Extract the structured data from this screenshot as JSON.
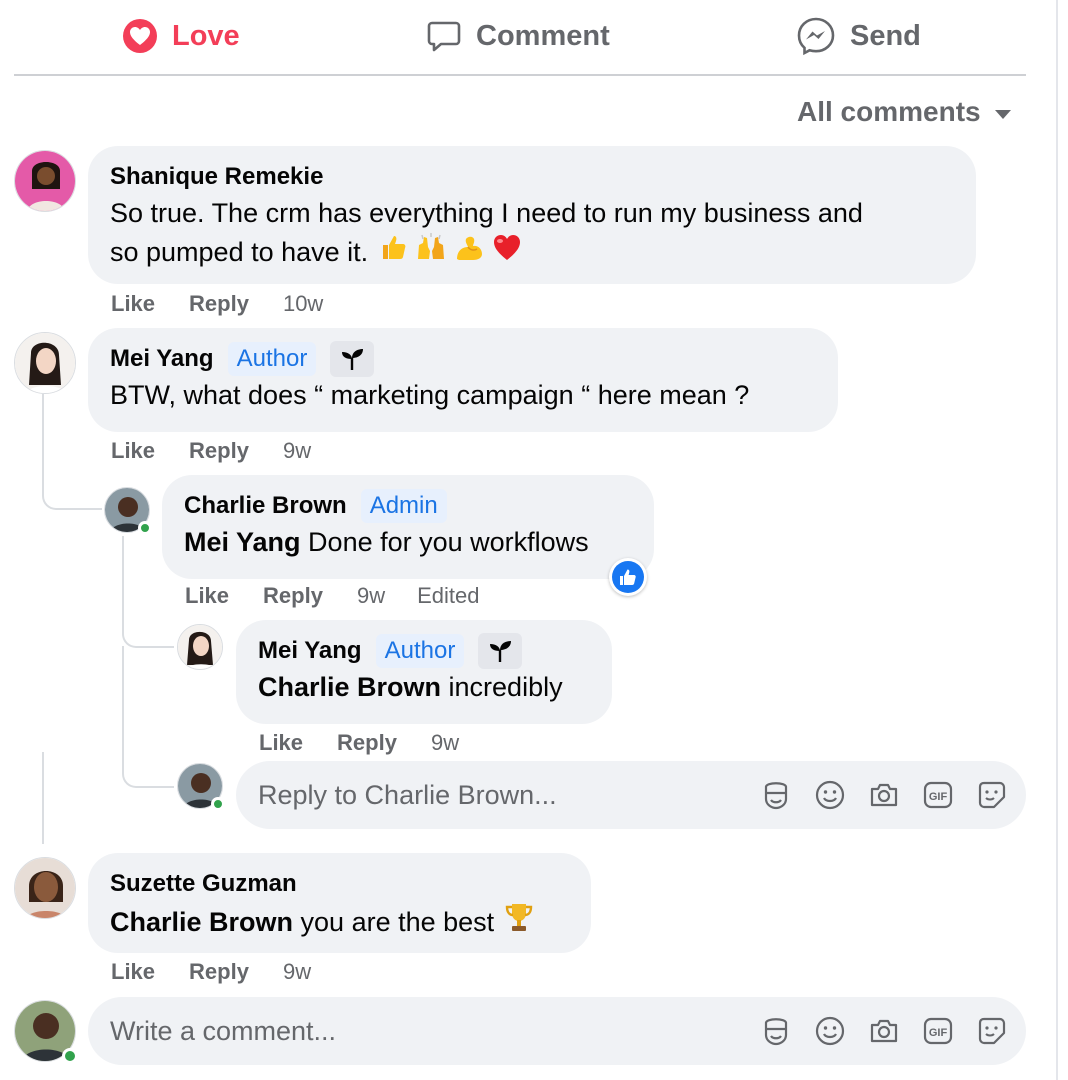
{
  "actions": {
    "love_label": "Love",
    "comment_label": "Comment",
    "send_label": "Send"
  },
  "filter": {
    "label": "All comments"
  },
  "comments": [
    {
      "author": "Shanique Remekie",
      "text_line1": "So true. The crm has everything I need to run my business and",
      "text_line2": "so pumped to have it.",
      "emojis": [
        "thumbs-up",
        "raising-hands",
        "flexed-biceps",
        "red-heart"
      ],
      "like": "Like",
      "reply": "Reply",
      "time": "10w"
    },
    {
      "author": "Mei Yang",
      "badge": "Author",
      "text": "BTW, what does “ marketing campaign “ here mean ?",
      "like": "Like",
      "reply": "Reply",
      "time": "9w",
      "replies": [
        {
          "author": "Charlie Brown",
          "badge": "Admin",
          "mention": "Mei Yang",
          "text": " Done for you workflows",
          "reaction": "like",
          "like": "Like",
          "reply": "Reply",
          "time": "9w",
          "edited": "Edited"
        },
        {
          "author": "Mei Yang",
          "badge": "Author",
          "mention": "Charlie Brown",
          "text": " incredibly",
          "like": "Like",
          "reply": "Reply",
          "time": "9w"
        }
      ],
      "reply_input_placeholder": "Reply to Charlie Brown..."
    },
    {
      "author": "Suzette Guzman",
      "mention": "Charlie Brown",
      "text": " you are the best",
      "emoji": "trophy",
      "like": "Like",
      "reply": "Reply",
      "time": "9w"
    }
  ],
  "composer": {
    "placeholder": "Write a comment..."
  },
  "input_icons": [
    "avatar-sticker-icon",
    "emoji-icon",
    "camera-icon",
    "gif-icon",
    "sticker-icon"
  ],
  "colors": {
    "love": "#f33e58",
    "badge_text": "#1b74e4",
    "online": "#31a24c",
    "like_reaction": "#1877f2"
  }
}
